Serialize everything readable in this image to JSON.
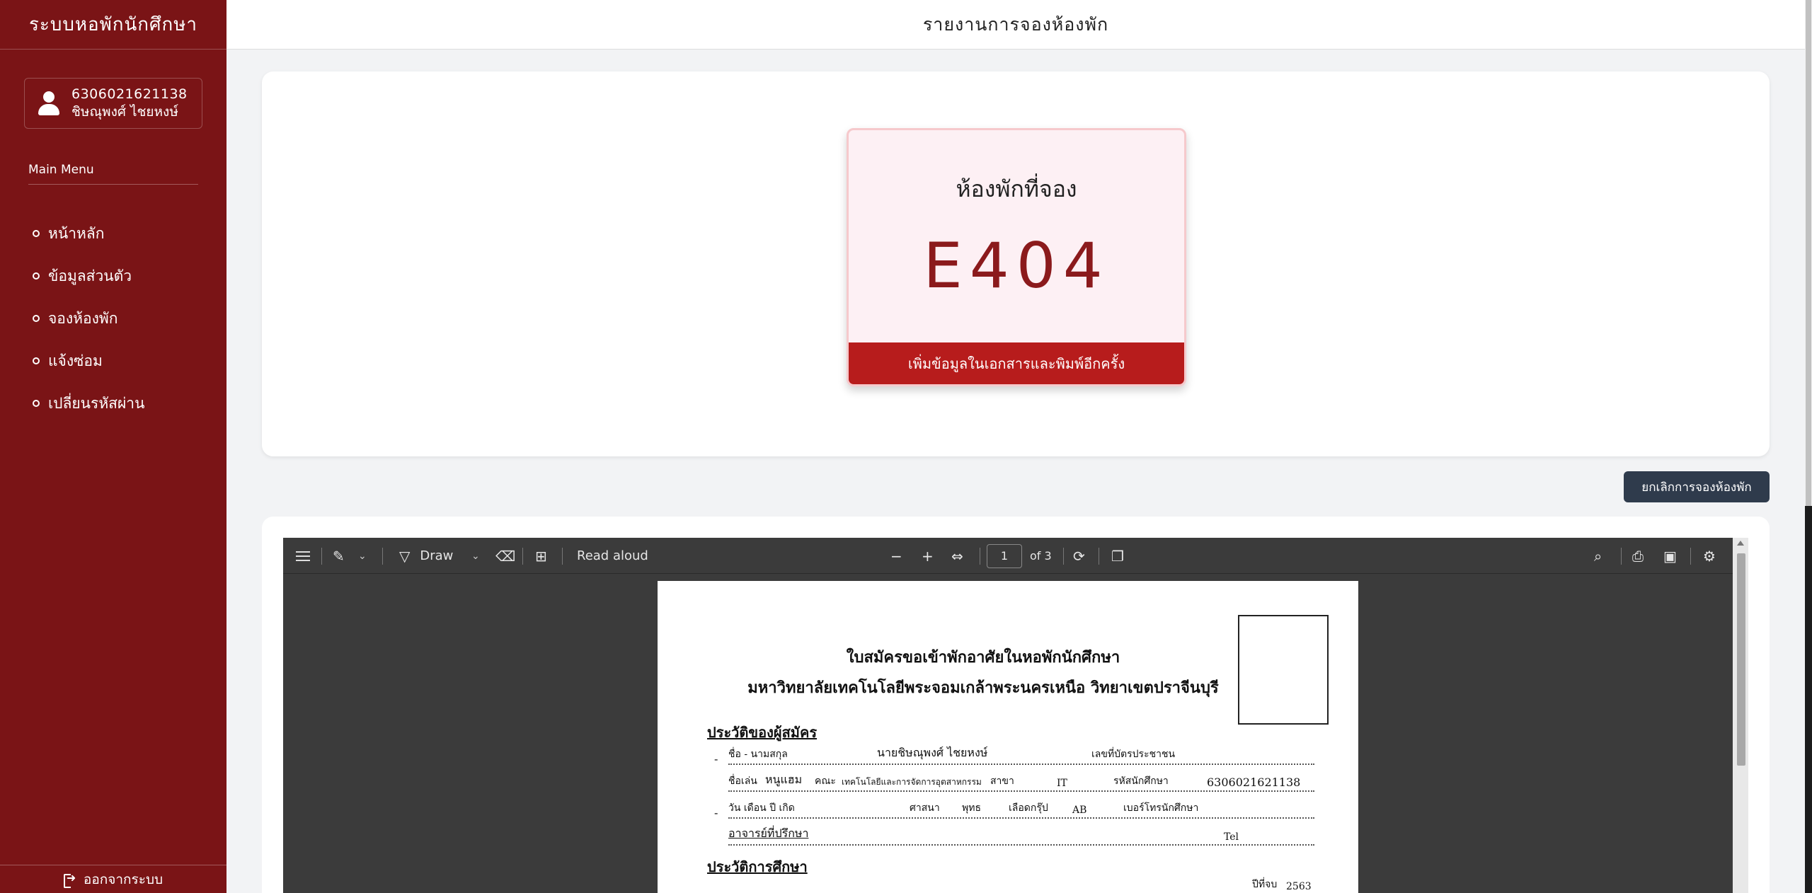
{
  "sidebar": {
    "brand": "ระบบหอพักนักศึกษา",
    "user": {
      "id": "6306021621138",
      "name": "ชิษณุพงศ์ ไชยหงษ์"
    },
    "menu_title": "Main Menu",
    "items": [
      {
        "label": "หน้าหลัก"
      },
      {
        "label": "ข้อมูลส่วนตัว"
      },
      {
        "label": "จองห้องพัก"
      },
      {
        "label": "แจ้งซ่อม"
      },
      {
        "label": "เปลี่ยนรหัสผ่าน"
      }
    ],
    "logout": "ออกจากระบบ"
  },
  "header": {
    "title": "รายงานการจองห้องพัก"
  },
  "booking": {
    "card_title": "ห้องพักที่จอง",
    "room": "E404",
    "action": "เพิ่มข้อมูลในเอกสารและพิมพ์อีกครั้ง",
    "cancel": "ยกเลิกการจองห้องพัก"
  },
  "pdf": {
    "toolbar": {
      "draw": "Draw",
      "read_aloud": "Read aloud",
      "page": "1",
      "of_pages": "of 3"
    },
    "doc": {
      "title1": "ใบสมัครขอเข้าพักอาศัยในหอพักนักศึกษา",
      "title2": "มหาวิทยาลัยเทคโนโลยีพระจอมเกล้าพระนครเหนือ  วิทยาเขตปราจีนบุรี",
      "section1": "ประวัติของผู้สมัคร",
      "line1_label": "ชื่อ - นามสกุล",
      "line1_value": "นายชิษณุพงศ์  ไชยหงษ์",
      "line1_label2": "เลขที่บัตรประชาชน",
      "line2_label": "ชื่อเล่น",
      "line2_nick": "หนูแฮม",
      "line2_faculty_label": "คณะ",
      "line2_faculty": "เทคโนโลยีและการจัดการอุตสาหกรรม",
      "line2_major_label": "สาขา",
      "line2_major": "IT",
      "line2_sid_label": "รหัสนักศึกษา",
      "line2_sid": "6306021621138",
      "line3_label": "วัน เดือน ปี เกิด",
      "line3_religion_label": "ศาสนา",
      "line3_religion": "พุทธ",
      "line3_blood_label": "เลือดกรุ๊ป",
      "line3_blood": "AB",
      "line3_tel_label": "เบอร์โทรนักศึกษา",
      "line4_label": "อาจารย์ที่ปรึกษา",
      "line4_tel": "Tel",
      "section2": "ประวัติการศึกษา",
      "line5_year_label": "ปีที่จบ",
      "line5_year": "2563"
    }
  }
}
